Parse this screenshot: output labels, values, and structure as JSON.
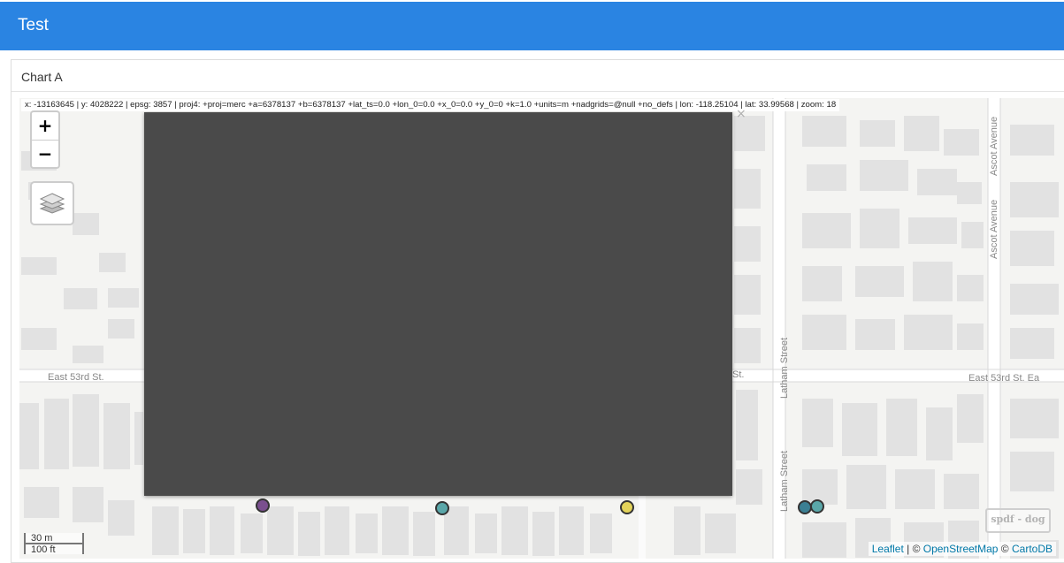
{
  "app": {
    "title": "Test"
  },
  "panel": {
    "title": "Chart A"
  },
  "map": {
    "coord_readout": "x: -13163645 | y: 4028222 | epsg: 3857 | proj4: +proj=merc +a=6378137 +b=6378137 +lat_ts=0.0 +lon_0=0.0 +x_0=0.0 +y_0=0 +k=1.0 +units=m +nadgrids=@null +no_defs | lon: -118.25104 | lat: 33.99568 | zoom: 18",
    "zoom_in_label": "+",
    "zoom_out_label": "−",
    "layers_icon": "layers-icon",
    "popup_close": "×",
    "scale": {
      "metric": "30 m",
      "imperial": "100 ft"
    },
    "watermark": "spdf - dog",
    "attribution": {
      "leaflet": "Leaflet",
      "sep1": " | © ",
      "osm": "OpenStreetMap",
      "sep2": " © ",
      "carto": "CartoDB"
    },
    "streets": {
      "east_53rd_left": "East 53rd St.",
      "east_53rd_mid": "St.",
      "east_53rd_right": "East 53rd St. Ea",
      "latham_1": "Latham Street",
      "latham_2": "Latham Street",
      "ascot_1": "Ascot Avenue",
      "ascot_2": "Ascot Avenue"
    },
    "markers": [
      {
        "name": "marker-purple",
        "color": "#7a4f8f"
      },
      {
        "name": "marker-teal-1",
        "color": "#5aa7a9"
      },
      {
        "name": "marker-yellow",
        "color": "#e3d35a"
      },
      {
        "name": "marker-teal-2",
        "color": "#3b7f93"
      },
      {
        "name": "marker-teal-3",
        "color": "#5aa7a9"
      }
    ],
    "colors": {
      "header": "#2a84e2",
      "map_background": "#f4f4f2",
      "building": "#e3e3e3",
      "road": "#ffffff",
      "overlay": "#4a4a4a"
    }
  }
}
